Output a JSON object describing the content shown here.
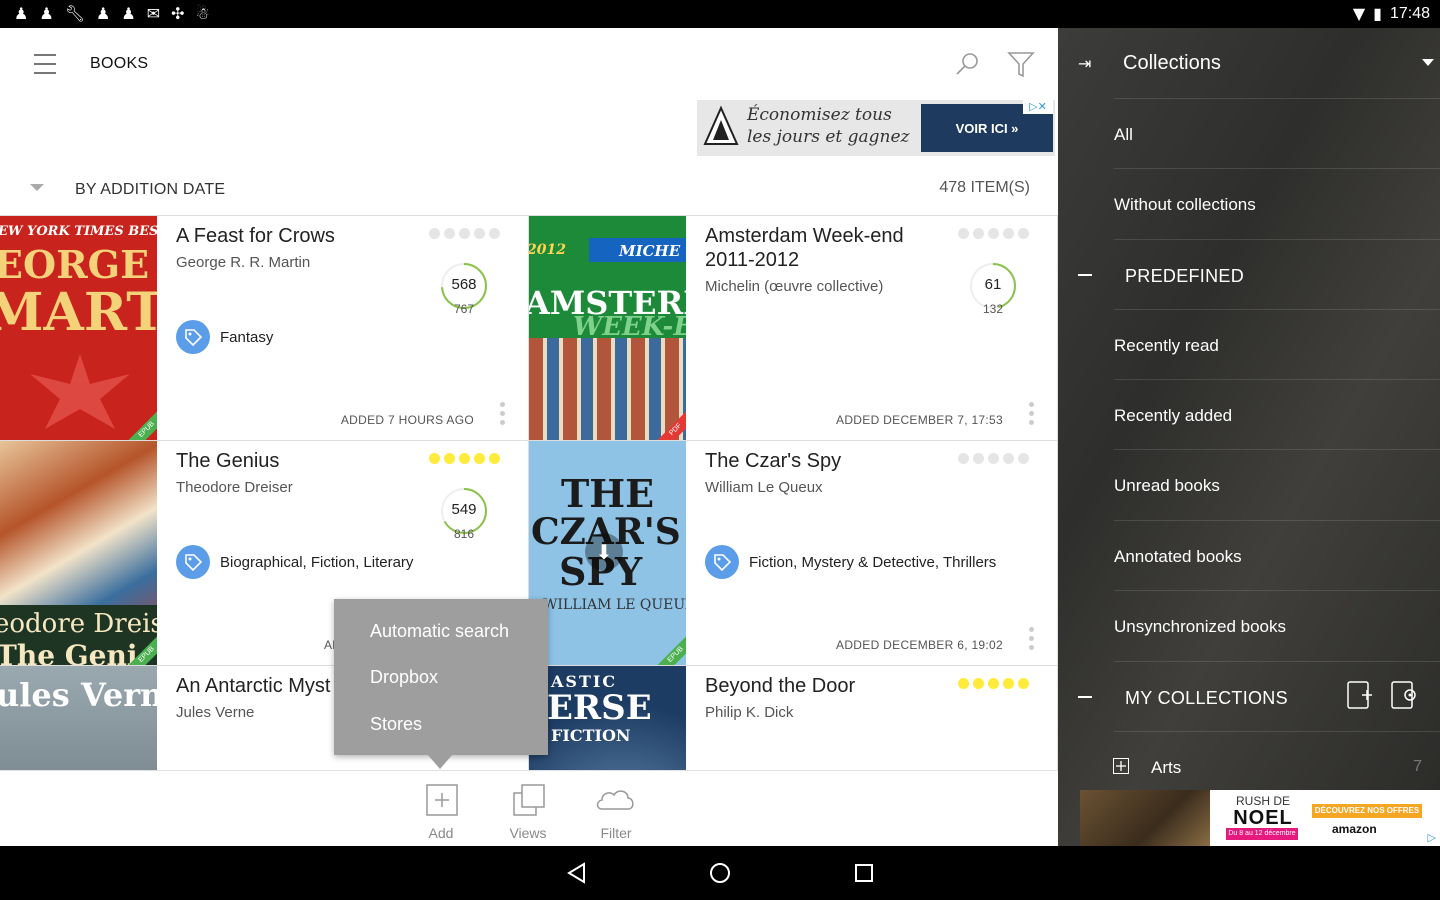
{
  "status": {
    "time": "17:48",
    "notification_icons": [
      "chess-pawn-icon",
      "chess-pawn-icon",
      "wrench-icon",
      "chess-pawn-icon",
      "chess-pawn-icon",
      "mail-icon",
      "pinwheel-icon",
      "android-icon"
    ]
  },
  "appbar": {
    "title": "BOOKS"
  },
  "ad_top": {
    "text": "Économisez tous les jours et gagnez",
    "cta": "VOIR ICI »"
  },
  "sortbar": {
    "label": "BY ADDITION DATE",
    "count": "478 ITEM(S)"
  },
  "books": [
    {
      "title": "A Feast for Crows",
      "author": "George R. R. Martin",
      "rating": 0,
      "read": "568",
      "total": "767",
      "progress": 0.74,
      "tags": "Fantasy",
      "added": "ADDED 7 HOURS AGO",
      "cover_lines": [
        "EW YORK TIMES BESTSE",
        "EORGE R.",
        "MARTI"
      ],
      "cover_color": "#c8241d",
      "format": "EPUB"
    },
    {
      "title": "Amsterdam Week-end 2011-2012",
      "author": "Michelin (œuvre collective)",
      "rating": 0,
      "read": "61",
      "total": "132",
      "progress": 0.46,
      "tags": "",
      "added": "ADDED DECEMBER 7, 17:53",
      "cover_lines": [
        "2012",
        "MICHE",
        "AMSTERDA",
        "WEEK-EI"
      ],
      "cover_color": "#1d8a3a",
      "format": "PDF"
    },
    {
      "title": "The Genius",
      "author": "Theodore Dreiser",
      "rating": 5,
      "read": "549",
      "total": "816",
      "progress": 0.67,
      "tags": "Biographical, Fiction, Literary",
      "added": "ADDED",
      "cover_lines": [
        "eodore Dreis",
        "The Geni"
      ],
      "cover_color": "#b5542a",
      "format": "EPUB"
    },
    {
      "title": "The Czar's Spy",
      "author": "William Le Queux",
      "rating": 0,
      "read": "",
      "total": "",
      "progress": 0,
      "tags": "Fiction, Mystery & Detective, Thrillers",
      "added": "ADDED DECEMBER 6, 19:02",
      "cover_lines": [
        "THE",
        "CZAR'S",
        "SPY",
        "WILLIAM LE QUEUX"
      ],
      "cover_color": "#8ec3e6",
      "format": "EPUB"
    },
    {
      "title": "An Antarctic Myst",
      "author": "Jules Verne",
      "rating": 0,
      "cover_lines": [
        "ules Vern"
      ],
      "cover_color": "#7d8f9a"
    },
    {
      "title": "Beyond the Door",
      "author": "Philip K. Dick",
      "rating": 5,
      "cover_lines": [
        "ASTIC",
        "ERSE",
        "FICTION"
      ],
      "cover_color": "#2d5a8a"
    }
  ],
  "popup": {
    "items": [
      "Automatic search",
      "Dropbox",
      "Stores"
    ]
  },
  "bottombar": {
    "add": "Add",
    "views": "Views",
    "filter": "Filter"
  },
  "sidebar": {
    "title": "Collections",
    "items": [
      "All",
      "Without collections"
    ],
    "predefined_header": "PREDEFINED",
    "predefined": [
      "Recently read",
      "Recently added",
      "Unread books",
      "Annotated books",
      "Unsynchronized books"
    ],
    "my_header": "MY COLLECTIONS",
    "collections": [
      {
        "label": "Arts",
        "count": "7"
      }
    ]
  },
  "ad_bottom": {
    "line1": "RUSH DE",
    "line2": "NOEL",
    "dates": "Du 8 au 12 décembre",
    "offers": "DÉCOUVREZ NOS OFFRES",
    "brand": "amazon"
  },
  "colors": {
    "accent_yellow": "#ffeb3b",
    "tag_blue": "#5b9de8",
    "ring_green": "#8bc34a",
    "pink": "#e91e63"
  }
}
